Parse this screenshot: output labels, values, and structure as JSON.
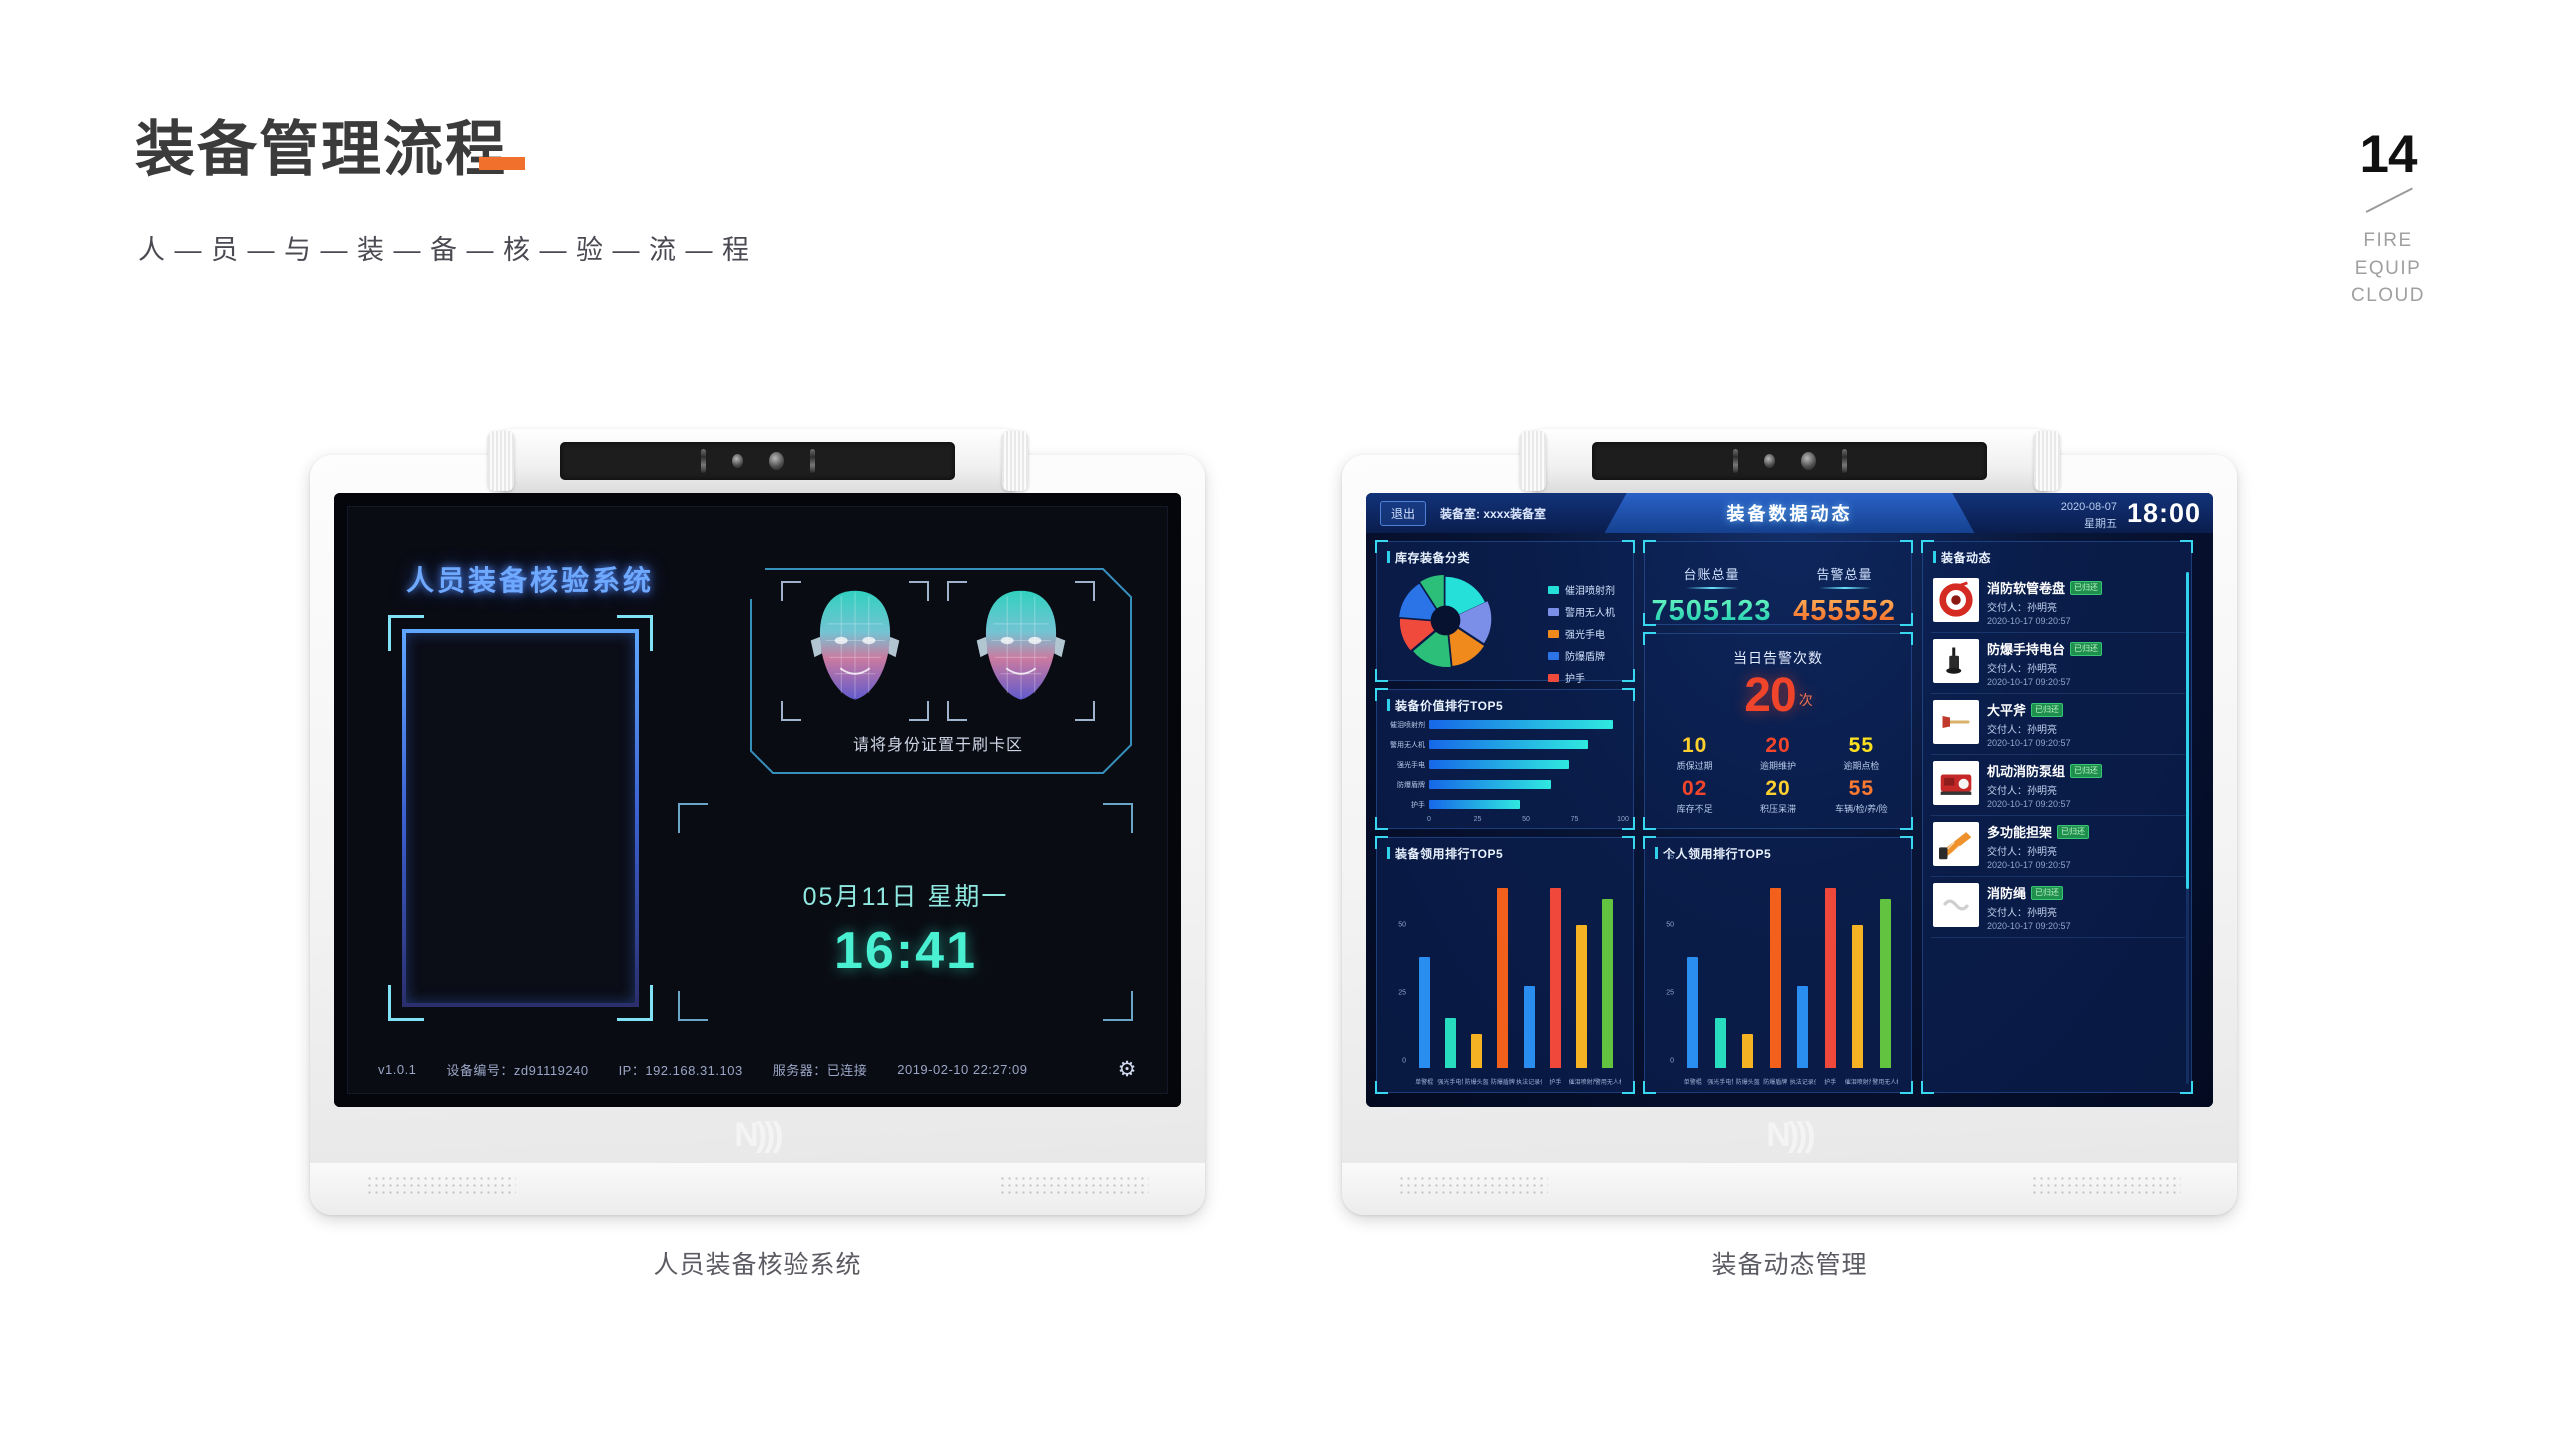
{
  "slide": {
    "title": "装备管理流程",
    "subtitle": "人 — 员 — 与 — 装 — 备 — 核 — 验 — 流 — 程",
    "page_number": "14",
    "brand": {
      "line1": "FIRE",
      "line2": "EQUIP",
      "line3": "CLOUD"
    },
    "accent_color": "#f1702b"
  },
  "devices": [
    {
      "caption": "人员装备核验系统"
    },
    {
      "caption": "装备动态管理"
    }
  ],
  "verification_screen": {
    "title": "人员装备核验系统",
    "face_hint": "请将身份证置于刷卡区",
    "date": "05月11日 星期一",
    "time": "16:41",
    "status": {
      "version": "v1.0.1",
      "device_id": "设备编号：zd91119240",
      "ip": "IP：192.168.31.103",
      "server": "服务器：已连接",
      "timestamp": "2019-02-10 22:27:09",
      "settings_icon": "gear-icon"
    }
  },
  "dashboard": {
    "logout": "退出",
    "room": "装备室: xxxx装备室",
    "title": "装备数据动态",
    "date": "2020-08-07",
    "weekday": "星期五",
    "clock": "18:00",
    "kpis": [
      {
        "label": "台账总量",
        "value": "7505123",
        "color": "#2fe0a8"
      },
      {
        "label": "告警总量",
        "value": "455552",
        "color": "#f4601f"
      }
    ],
    "alarm": {
      "title": "当日告警次数",
      "count": "20",
      "unit": "次",
      "cells": [
        {
          "value": "10",
          "label": "质保过期",
          "color": "#ffcf2e"
        },
        {
          "value": "20",
          "label": "逾期维护",
          "color": "#f4452b"
        },
        {
          "value": "55",
          "label": "逾期点检",
          "color": "#ffe21f"
        },
        {
          "value": "02",
          "label": "库存不足",
          "color": "#f4452b"
        },
        {
          "value": "20",
          "label": "积压呆滞",
          "color": "#ffcf2e"
        },
        {
          "value": "55",
          "label": "车辆/检/养/险",
          "color": "#ff7a2e"
        }
      ]
    },
    "equipment_panel_title": "装备动态",
    "equipment": [
      {
        "name": "消防软管卷盘",
        "badge": "已归还",
        "person": "交付人：孙明亮",
        "time": "2020-10-17 09:20:57",
        "icon": "hose-reel-icon"
      },
      {
        "name": "防爆手持电台",
        "badge": "已归还",
        "person": "交付人：孙明亮",
        "time": "2020-10-17 09:20:57",
        "icon": "radio-icon"
      },
      {
        "name": "大平斧",
        "badge": "已归还",
        "person": "交付人：孙明亮",
        "time": "2020-10-17 09:20:57",
        "icon": "axe-icon"
      },
      {
        "name": "机动消防泵组",
        "badge": "已归还",
        "person": "交付人：孙明亮",
        "time": "2020-10-17 09:20:57",
        "icon": "pump-icon"
      },
      {
        "name": "多功能担架",
        "badge": "已归还",
        "person": "交付人：孙明亮",
        "time": "2020-10-17 09:20:57",
        "icon": "stretcher-icon"
      },
      {
        "name": "消防绳",
        "badge": "已归还",
        "person": "交付人：孙明亮",
        "time": "2020-10-17 09:20:57",
        "icon": "rope-icon"
      }
    ]
  },
  "chart_data": [
    {
      "type": "pie",
      "title": "库存装备分类",
      "labels": [
        "催泪喷射剂",
        "警用无人机",
        "强光手电",
        "防爆盾牌",
        "护手"
      ],
      "values": [
        26,
        8,
        17,
        24,
        25
      ],
      "colors": [
        "#24e0d8",
        "#7b8fe8",
        "#f08a1c",
        "#2a74e8",
        "#f04a3c"
      ],
      "legend_position": "right",
      "extra_colors": [
        "#2bbf7a"
      ]
    },
    {
      "type": "bar",
      "orientation": "horizontal",
      "title": "装备价值排行TOP5",
      "categories": [
        "催泪喷射剂",
        "警用无人机",
        "强光手电",
        "防爆盾牌",
        "护手"
      ],
      "values": [
        95,
        82,
        72,
        63,
        47
      ],
      "xlabel": "",
      "ylabel": "",
      "xticks": [
        0,
        25,
        50,
        75,
        100
      ],
      "xlim": [
        0,
        100
      ],
      "grid": true,
      "bar_gradient": [
        "#1667e8",
        "#2fe9e0"
      ]
    },
    {
      "type": "bar",
      "orientation": "vertical",
      "title": "装备领用排行TOP5",
      "categories": [
        "单警棍",
        "强光手电筒",
        "防爆头盔",
        "防爆盾牌",
        "执法记录仪",
        "护手",
        "催泪喷射剂",
        "警用无人机"
      ],
      "values": [
        42,
        19,
        13,
        68,
        31,
        68,
        54,
        64
      ],
      "colors": [
        "#2a8ef0",
        "#28dcc0",
        "#f5b324",
        "#f2601c",
        "#2a8ef0",
        "#f0493c",
        "#f5b324",
        "#62c341"
      ],
      "yticks": [
        0,
        25,
        50,
        75
      ],
      "ylim": [
        0,
        75
      ],
      "grid": true
    },
    {
      "type": "bar",
      "orientation": "vertical",
      "title": "个人领用排行TOP5",
      "categories": [
        "单警棍",
        "强光手电筒",
        "防爆头盔",
        "防爆盾牌",
        "执法记录仪",
        "护手",
        "催泪喷射剂",
        "警用无人机"
      ],
      "values": [
        42,
        19,
        13,
        68,
        31,
        68,
        54,
        64
      ],
      "colors": [
        "#2a8ef0",
        "#28dcc0",
        "#f5b324",
        "#f2601c",
        "#2a8ef0",
        "#f0493c",
        "#f5b324",
        "#62c341"
      ],
      "yticks": [
        0,
        25,
        50,
        75
      ],
      "ylim": [
        0,
        75
      ],
      "grid": true
    }
  ]
}
